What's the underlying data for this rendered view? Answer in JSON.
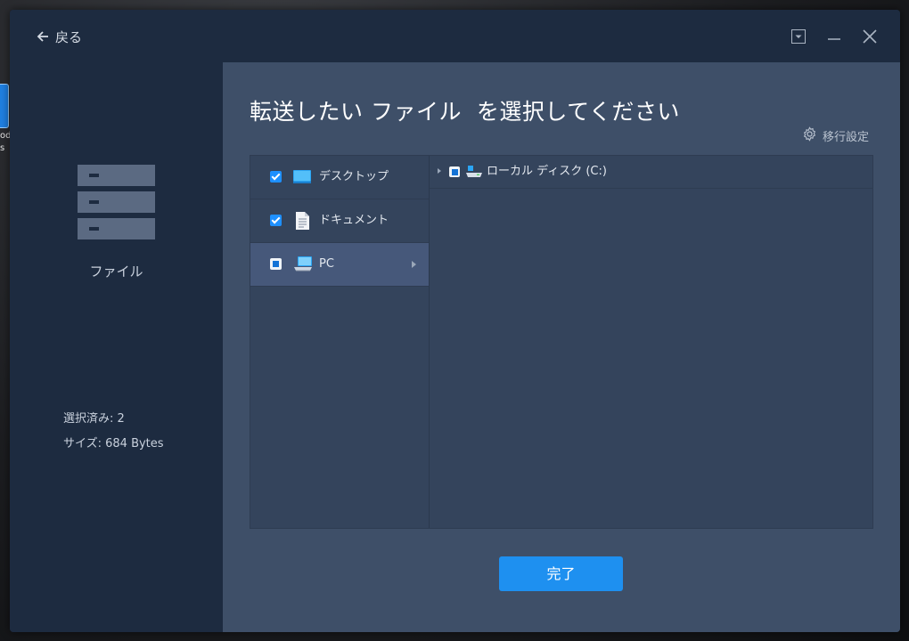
{
  "desktop": {
    "icon_label": "od\ns"
  },
  "titlebar": {
    "back_label": "戻る"
  },
  "sidebar": {
    "category_label": "ファイル",
    "selected_text": "選択済み:  2",
    "size_text": "サイズ:  684 Bytes"
  },
  "main": {
    "title": "転送したい ファイル  を選択してください",
    "transfer_settings_label": "移行設定",
    "categories": [
      {
        "label": "デスクトップ",
        "icon": "desktop-icon",
        "state": "checked"
      },
      {
        "label": "ドキュメント",
        "icon": "document-icon",
        "state": "checked"
      },
      {
        "label": "PC",
        "icon": "pc-icon",
        "state": "partial"
      }
    ],
    "tree": [
      {
        "label": "ローカル ディスク (C:)",
        "icon": "drive-icon",
        "state": "partial"
      }
    ],
    "done_label": "完了"
  },
  "colors": {
    "accent": "#1e90f0",
    "window_bg": "#1d2b40",
    "main_bg": "#3e4f68"
  }
}
